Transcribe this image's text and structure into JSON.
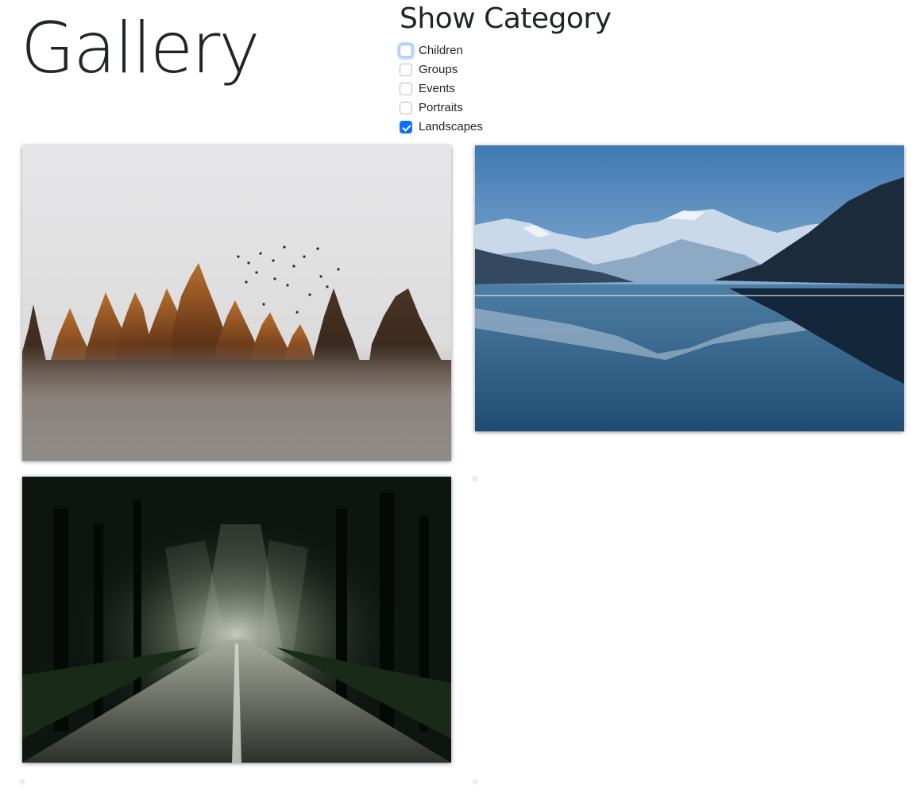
{
  "header": {
    "title": "Gallery"
  },
  "filters": {
    "heading": "Show Category",
    "options": [
      {
        "label": "Children",
        "checked": false,
        "focused": true
      },
      {
        "label": "Groups",
        "checked": false,
        "focused": false
      },
      {
        "label": "Events",
        "checked": false,
        "focused": false
      },
      {
        "label": "Portraits",
        "checked": false,
        "focused": false
      },
      {
        "label": "Landscapes",
        "checked": true,
        "focused": false
      }
    ]
  },
  "colors": {
    "checkbox_checked": "#0d6efd",
    "text": "#212529"
  },
  "gallery": {
    "photos": [
      {
        "subject": "misty-forest-with-birds"
      },
      {
        "subject": "mountain-lake-reflection"
      },
      {
        "subject": "forest-road-with-light-rays"
      }
    ]
  }
}
